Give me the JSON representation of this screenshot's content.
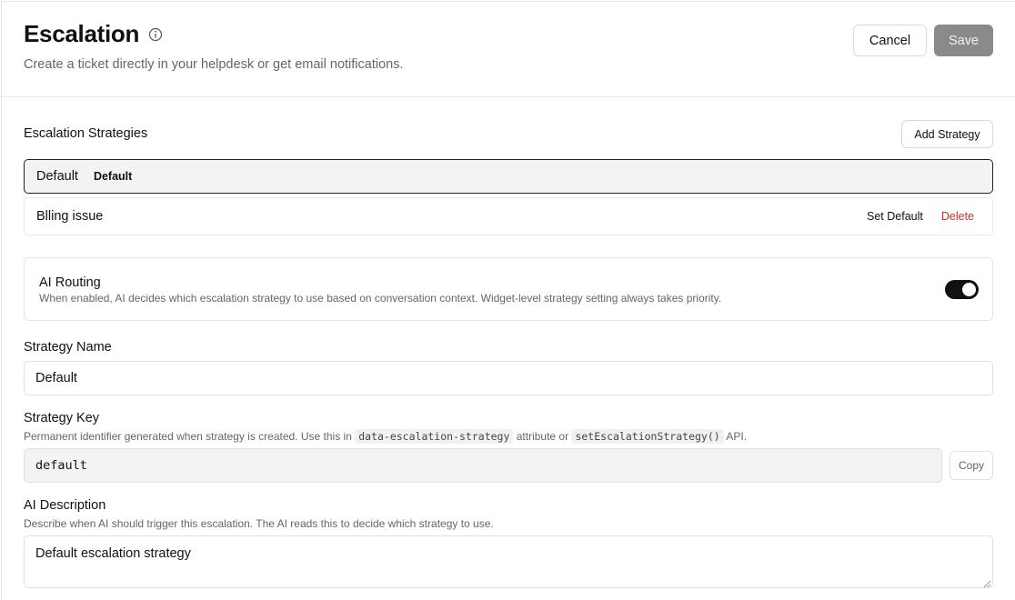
{
  "header": {
    "title": "Escalation",
    "subtitle": "Create a ticket directly in your helpdesk or get email notifications.",
    "cancel_label": "Cancel",
    "save_label": "Save"
  },
  "strategies": {
    "section_label": "Escalation Strategies",
    "add_label": "Add Strategy",
    "items": [
      {
        "name": "Default",
        "badge": "Default",
        "selected": true
      },
      {
        "name": "Blling issue",
        "set_default_label": "Set Default",
        "delete_label": "Delete",
        "selected": false
      }
    ]
  },
  "ai_routing": {
    "title": "AI Routing",
    "description": "When enabled, AI decides which escalation strategy to use based on conversation context. Widget-level strategy setting always takes priority.",
    "enabled": true
  },
  "strategy_name": {
    "label": "Strategy Name",
    "value": "Default"
  },
  "strategy_key": {
    "label": "Strategy Key",
    "help_prefix": "Permanent identifier generated when strategy is created. Use this in",
    "help_code1": "data-escalation-strategy",
    "help_middle": "attribute or",
    "help_code2": "setEscalationStrategy()",
    "help_suffix": "API.",
    "value": "default",
    "copy_label": "Copy"
  },
  "ai_description": {
    "label": "AI Description",
    "help": "Describe when AI should trigger this escalation. The AI reads this to decide which strategy to use.",
    "value": "Default escalation strategy"
  },
  "colors": {
    "danger": "#d92d20",
    "toggle_on": "#111111",
    "save_disabled": "#8a8a8a"
  },
  "icons": {
    "info": "info-circle-icon",
    "resize": "resize-handle-icon"
  }
}
